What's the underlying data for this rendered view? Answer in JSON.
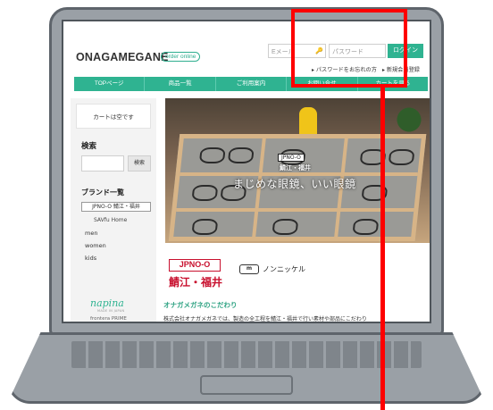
{
  "header": {
    "logo": "ONAGAMEGANE",
    "order_badge": "order online",
    "email_placeholder": "Eメール",
    "password_placeholder": "パスワード",
    "login_label": "ログイン",
    "forgot_link": "パスワードをお忘れの方",
    "register_link": "新規会員登録"
  },
  "nav": {
    "items": [
      "TOPページ",
      "商品一覧",
      "ご利用案内",
      "お問い合せ",
      "カートを見る"
    ]
  },
  "sidebar": {
    "cart_text": "カートは空です",
    "search_title": "検索",
    "search_button": "検索",
    "brand_title": "ブランド一覧",
    "brand_jpnoo": "JPNO-O 鯖江・福井",
    "brand_savfu": "SAVfu Home",
    "categories": [
      "men",
      "women",
      "kids"
    ],
    "napina": "napina",
    "napina_sub": "MADE IN JAPAN",
    "prime": "frontera PRIME",
    "categories2": [
      "men"
    ]
  },
  "hero": {
    "jpnoo": "JPNO-O",
    "sabae": "鯖江・福井",
    "copy": "まじめな眼鏡、いい眼鏡"
  },
  "content": {
    "jpnoo_logo": "JPNO-O",
    "sabae_fukui": "鯖江・福井",
    "nonnickel_badge": "m",
    "nonnickel": "ノンニッケル",
    "kodawari_title": "オナガメガネのこだわり",
    "body_text": "株式会社オナガメガネでは、製造の全工程を鯖江・福井で行い素材や部品にこだわり"
  },
  "colors": {
    "accent": "#2fb391",
    "annotation": "#ff0000",
    "brand_red": "#c8102e"
  }
}
